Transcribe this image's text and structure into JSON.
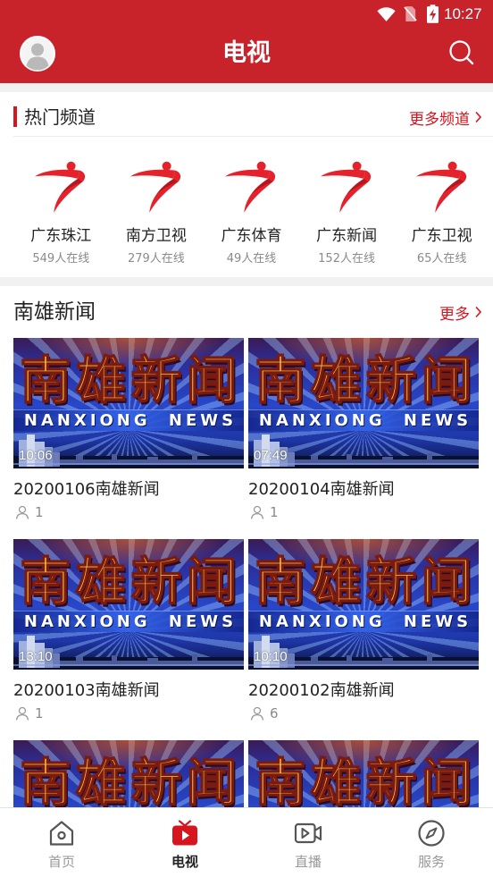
{
  "status_bar": {
    "time": "10:27",
    "icons": [
      "wifi-icon",
      "no-sim-icon",
      "battery-charging-icon"
    ]
  },
  "header": {
    "title": "电视",
    "left_icon": "avatar",
    "right_icon": "search-icon"
  },
  "hot_channels": {
    "title": "热门频道",
    "more_label": "更多频道",
    "more_icon": "chevron-right-icon",
    "items": [
      {
        "name": "广东珠江",
        "viewers": "549人在线",
        "logo": "gdtv-logo"
      },
      {
        "name": "南方卫视",
        "viewers": "279人在线",
        "logo": "gdtv-logo"
      },
      {
        "name": "广东体育",
        "viewers": "49人在线",
        "logo": "gdtv-logo"
      },
      {
        "name": "广东新闻",
        "viewers": "152人在线",
        "logo": "gdtv-logo"
      },
      {
        "name": "广东卫视",
        "viewers": "65人在线",
        "logo": "gdtv-logo"
      }
    ]
  },
  "news": {
    "title": "南雄新闻",
    "more_label": "更多",
    "more_icon": "chevron-right-icon",
    "views_icon": "person-icon",
    "thumbnail_text": {
      "title": "南雄新闻",
      "subtitle": "NANXIONG NEWS"
    },
    "videos": [
      {
        "title": "20200106南雄新闻",
        "duration": "10:06",
        "views": "1"
      },
      {
        "title": "20200104南雄新闻",
        "duration": "07:49",
        "views": "1"
      },
      {
        "title": "20200103南雄新闻",
        "duration": "13:10",
        "views": "1"
      },
      {
        "title": "20200102南雄新闻",
        "duration": "10:10",
        "views": "6"
      },
      {},
      {}
    ]
  },
  "bottom_nav": {
    "items": [
      {
        "label": "首页",
        "icon": "home-icon",
        "active": false
      },
      {
        "label": "电视",
        "icon": "tv-icon",
        "active": true
      },
      {
        "label": "直播",
        "icon": "live-video-icon",
        "active": false
      },
      {
        "label": "服务",
        "icon": "compass-icon",
        "active": false
      }
    ]
  },
  "colors": {
    "brand_red": "#c8232b",
    "link_red": "#d7151e",
    "logo_red": "#e3222b",
    "text_primary": "#222222",
    "text_secondary": "#8a8a8a",
    "nav_inactive": "#999999",
    "page_gap": "#f1f1f1"
  }
}
